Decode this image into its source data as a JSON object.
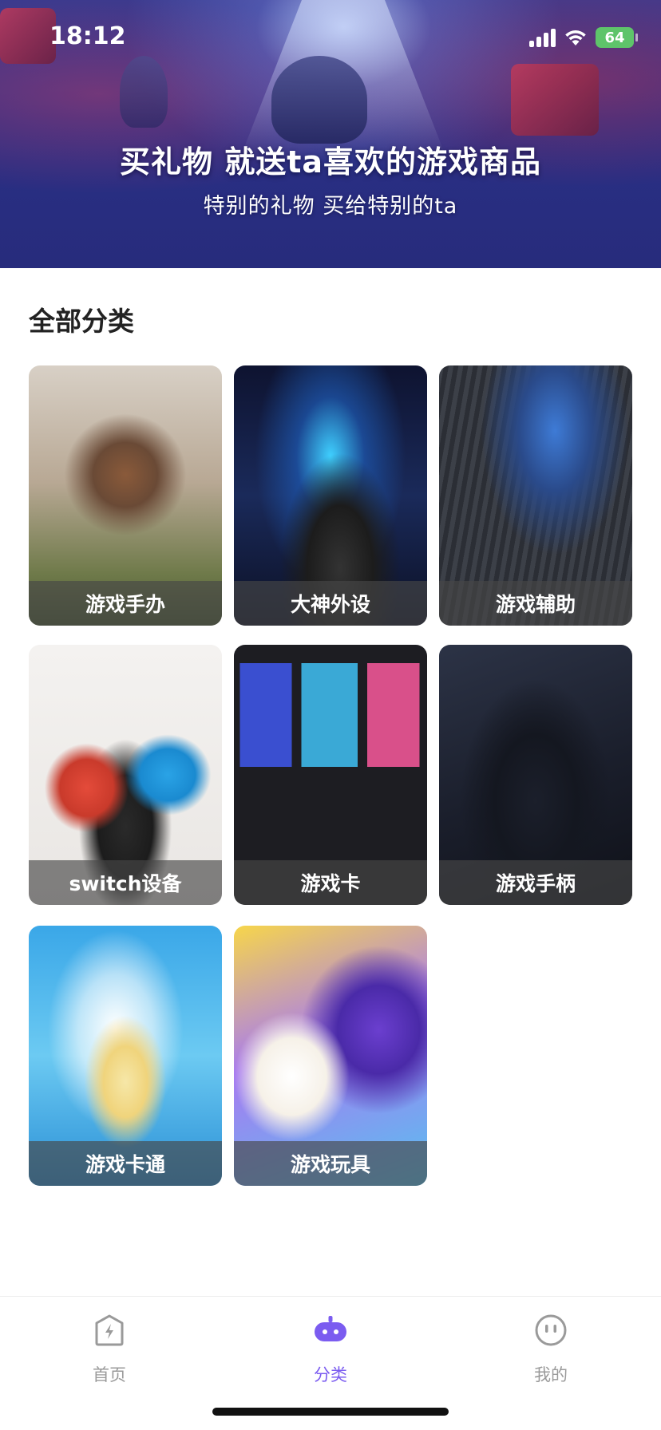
{
  "status_bar": {
    "time": "18:12",
    "battery": "64"
  },
  "banner": {
    "title": "买礼物 就送ta喜欢的游戏商品",
    "subtitle": "特别的礼物 买给特别的ta"
  },
  "section": {
    "title": "全部分类"
  },
  "categories": [
    {
      "label": "游戏手办"
    },
    {
      "label": "大神外设"
    },
    {
      "label": "游戏辅助"
    },
    {
      "label": "switch设备"
    },
    {
      "label": "游戏卡"
    },
    {
      "label": "游戏手柄"
    },
    {
      "label": "游戏卡通"
    },
    {
      "label": "游戏玩具"
    }
  ],
  "tabbar": {
    "items": [
      {
        "label": "首页",
        "icon": "home-icon"
      },
      {
        "label": "分类",
        "icon": "gamepad-icon",
        "active": true
      },
      {
        "label": "我的",
        "icon": "profile-icon"
      }
    ]
  },
  "colors": {
    "accent": "#7b5cf0",
    "tab_inactive": "#9a9a9a",
    "battery": "#5ec46a"
  }
}
